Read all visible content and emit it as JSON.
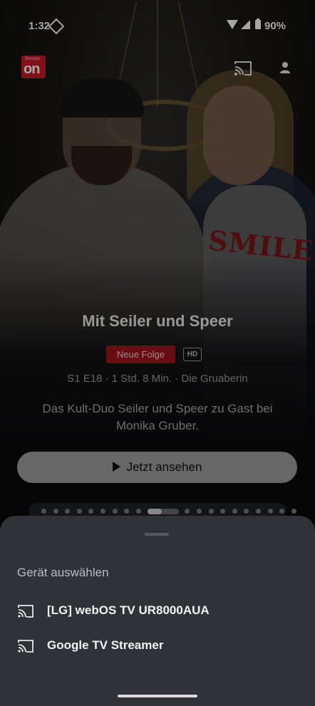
{
  "status_bar": {
    "time": "1:32",
    "battery": "90%"
  },
  "header": {
    "logo_text": "on",
    "logo_script": "Servus"
  },
  "hero": {
    "title": "Mit Seiler und Speer",
    "badge_new": "Neue Folge",
    "badge_hd": "HD",
    "meta": "S1 E18 · 1 Std. 8 Min. · Die Gruaberin",
    "description": "Das Kult-Duo Seiler und Speer zu Gast bei Monika Gruber.",
    "shirt_text": "SMILE",
    "watch_label": "Jetzt ansehen"
  },
  "carousel": {
    "total_dots": 20,
    "active_index": 9
  },
  "cast_sheet": {
    "title": "Gerät auswählen",
    "devices": [
      {
        "name": "[LG] webOS TV UR8000AUA",
        "icon": "cast-icon"
      },
      {
        "name": "Google TV Streamer",
        "icon": "cast-icon"
      }
    ]
  },
  "colors": {
    "accent": "#a3151c",
    "sheet": "#2f3338",
    "logo": "#c51d24"
  }
}
